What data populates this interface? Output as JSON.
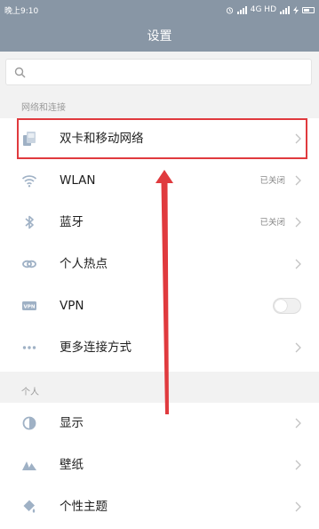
{
  "status_bar": {
    "time": "晚上9:10",
    "network_label": "4G HD"
  },
  "header": {
    "title": "设置"
  },
  "search": {
    "placeholder": ""
  },
  "sections": [
    {
      "title": "网络和连接",
      "items": [
        {
          "label": "双卡和移动网络",
          "icon": "sim-cards-icon"
        },
        {
          "label": "WLAN",
          "status": "已关闭",
          "icon": "wifi-icon"
        },
        {
          "label": "蓝牙",
          "status": "已关闭",
          "icon": "bluetooth-icon"
        },
        {
          "label": "个人热点",
          "icon": "hotspot-icon"
        },
        {
          "label": "VPN",
          "icon": "vpn-icon",
          "toggle": "off"
        },
        {
          "label": "更多连接方式",
          "icon": "more-dots-icon"
        }
      ]
    },
    {
      "title": "个人",
      "items": [
        {
          "label": "显示",
          "icon": "display-icon"
        },
        {
          "label": "壁纸",
          "icon": "wallpaper-icon"
        },
        {
          "label": "个性主题",
          "icon": "theme-icon"
        }
      ]
    }
  ],
  "colors": {
    "bar": "#8896a5",
    "icon": "#9fb1c5",
    "annotation": "#e03a3e"
  }
}
